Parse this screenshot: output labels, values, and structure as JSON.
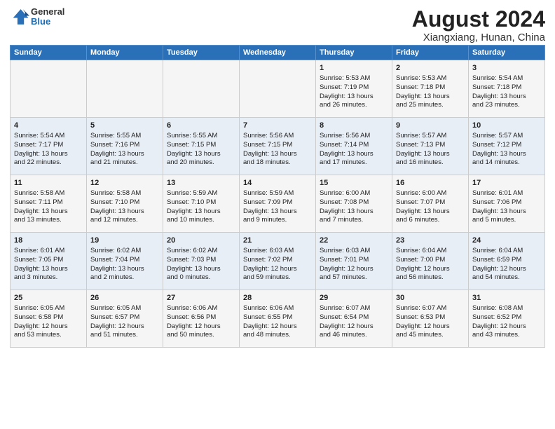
{
  "header": {
    "logo_general": "General",
    "logo_blue": "Blue",
    "month_title": "August 2024",
    "subtitle": "Xiangxiang, Hunan, China"
  },
  "weekdays": [
    "Sunday",
    "Monday",
    "Tuesday",
    "Wednesday",
    "Thursday",
    "Friday",
    "Saturday"
  ],
  "weeks": [
    [
      {
        "day": "",
        "lines": []
      },
      {
        "day": "",
        "lines": []
      },
      {
        "day": "",
        "lines": []
      },
      {
        "day": "",
        "lines": []
      },
      {
        "day": "1",
        "lines": [
          "Sunrise: 5:53 AM",
          "Sunset: 7:19 PM",
          "Daylight: 13 hours",
          "and 26 minutes."
        ]
      },
      {
        "day": "2",
        "lines": [
          "Sunrise: 5:53 AM",
          "Sunset: 7:18 PM",
          "Daylight: 13 hours",
          "and 25 minutes."
        ]
      },
      {
        "day": "3",
        "lines": [
          "Sunrise: 5:54 AM",
          "Sunset: 7:18 PM",
          "Daylight: 13 hours",
          "and 23 minutes."
        ]
      }
    ],
    [
      {
        "day": "4",
        "lines": [
          "Sunrise: 5:54 AM",
          "Sunset: 7:17 PM",
          "Daylight: 13 hours",
          "and 22 minutes."
        ]
      },
      {
        "day": "5",
        "lines": [
          "Sunrise: 5:55 AM",
          "Sunset: 7:16 PM",
          "Daylight: 13 hours",
          "and 21 minutes."
        ]
      },
      {
        "day": "6",
        "lines": [
          "Sunrise: 5:55 AM",
          "Sunset: 7:15 PM",
          "Daylight: 13 hours",
          "and 20 minutes."
        ]
      },
      {
        "day": "7",
        "lines": [
          "Sunrise: 5:56 AM",
          "Sunset: 7:15 PM",
          "Daylight: 13 hours",
          "and 18 minutes."
        ]
      },
      {
        "day": "8",
        "lines": [
          "Sunrise: 5:56 AM",
          "Sunset: 7:14 PM",
          "Daylight: 13 hours",
          "and 17 minutes."
        ]
      },
      {
        "day": "9",
        "lines": [
          "Sunrise: 5:57 AM",
          "Sunset: 7:13 PM",
          "Daylight: 13 hours",
          "and 16 minutes."
        ]
      },
      {
        "day": "10",
        "lines": [
          "Sunrise: 5:57 AM",
          "Sunset: 7:12 PM",
          "Daylight: 13 hours",
          "and 14 minutes."
        ]
      }
    ],
    [
      {
        "day": "11",
        "lines": [
          "Sunrise: 5:58 AM",
          "Sunset: 7:11 PM",
          "Daylight: 13 hours",
          "and 13 minutes."
        ]
      },
      {
        "day": "12",
        "lines": [
          "Sunrise: 5:58 AM",
          "Sunset: 7:10 PM",
          "Daylight: 13 hours",
          "and 12 minutes."
        ]
      },
      {
        "day": "13",
        "lines": [
          "Sunrise: 5:59 AM",
          "Sunset: 7:10 PM",
          "Daylight: 13 hours",
          "and 10 minutes."
        ]
      },
      {
        "day": "14",
        "lines": [
          "Sunrise: 5:59 AM",
          "Sunset: 7:09 PM",
          "Daylight: 13 hours",
          "and 9 minutes."
        ]
      },
      {
        "day": "15",
        "lines": [
          "Sunrise: 6:00 AM",
          "Sunset: 7:08 PM",
          "Daylight: 13 hours",
          "and 7 minutes."
        ]
      },
      {
        "day": "16",
        "lines": [
          "Sunrise: 6:00 AM",
          "Sunset: 7:07 PM",
          "Daylight: 13 hours",
          "and 6 minutes."
        ]
      },
      {
        "day": "17",
        "lines": [
          "Sunrise: 6:01 AM",
          "Sunset: 7:06 PM",
          "Daylight: 13 hours",
          "and 5 minutes."
        ]
      }
    ],
    [
      {
        "day": "18",
        "lines": [
          "Sunrise: 6:01 AM",
          "Sunset: 7:05 PM",
          "Daylight: 13 hours",
          "and 3 minutes."
        ]
      },
      {
        "day": "19",
        "lines": [
          "Sunrise: 6:02 AM",
          "Sunset: 7:04 PM",
          "Daylight: 13 hours",
          "and 2 minutes."
        ]
      },
      {
        "day": "20",
        "lines": [
          "Sunrise: 6:02 AM",
          "Sunset: 7:03 PM",
          "Daylight: 13 hours",
          "and 0 minutes."
        ]
      },
      {
        "day": "21",
        "lines": [
          "Sunrise: 6:03 AM",
          "Sunset: 7:02 PM",
          "Daylight: 12 hours",
          "and 59 minutes."
        ]
      },
      {
        "day": "22",
        "lines": [
          "Sunrise: 6:03 AM",
          "Sunset: 7:01 PM",
          "Daylight: 12 hours",
          "and 57 minutes."
        ]
      },
      {
        "day": "23",
        "lines": [
          "Sunrise: 6:04 AM",
          "Sunset: 7:00 PM",
          "Daylight: 12 hours",
          "and 56 minutes."
        ]
      },
      {
        "day": "24",
        "lines": [
          "Sunrise: 6:04 AM",
          "Sunset: 6:59 PM",
          "Daylight: 12 hours",
          "and 54 minutes."
        ]
      }
    ],
    [
      {
        "day": "25",
        "lines": [
          "Sunrise: 6:05 AM",
          "Sunset: 6:58 PM",
          "Daylight: 12 hours",
          "and 53 minutes."
        ]
      },
      {
        "day": "26",
        "lines": [
          "Sunrise: 6:05 AM",
          "Sunset: 6:57 PM",
          "Daylight: 12 hours",
          "and 51 minutes."
        ]
      },
      {
        "day": "27",
        "lines": [
          "Sunrise: 6:06 AM",
          "Sunset: 6:56 PM",
          "Daylight: 12 hours",
          "and 50 minutes."
        ]
      },
      {
        "day": "28",
        "lines": [
          "Sunrise: 6:06 AM",
          "Sunset: 6:55 PM",
          "Daylight: 12 hours",
          "and 48 minutes."
        ]
      },
      {
        "day": "29",
        "lines": [
          "Sunrise: 6:07 AM",
          "Sunset: 6:54 PM",
          "Daylight: 12 hours",
          "and 46 minutes."
        ]
      },
      {
        "day": "30",
        "lines": [
          "Sunrise: 6:07 AM",
          "Sunset: 6:53 PM",
          "Daylight: 12 hours",
          "and 45 minutes."
        ]
      },
      {
        "day": "31",
        "lines": [
          "Sunrise: 6:08 AM",
          "Sunset: 6:52 PM",
          "Daylight: 12 hours",
          "and 43 minutes."
        ]
      }
    ]
  ]
}
